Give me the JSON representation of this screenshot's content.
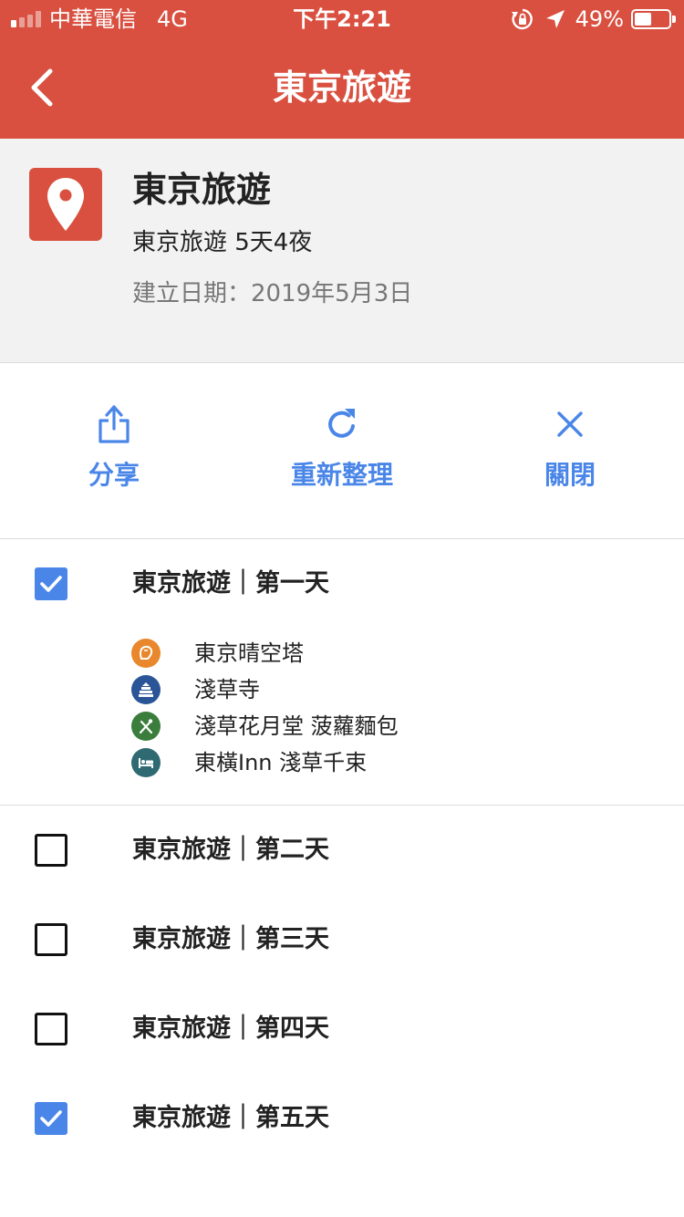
{
  "status_bar": {
    "carrier": "中華電信",
    "network": "4G",
    "time": "下午2:21",
    "battery_percent": "49%",
    "battery_level": 0.49,
    "signal_bars": 1,
    "icons": [
      "orientation-lock-icon",
      "location-arrow-icon",
      "battery-icon"
    ]
  },
  "header": {
    "title": "東京旅遊",
    "back_icon": "chevron-left-icon",
    "background_color": "#d95040"
  },
  "trip": {
    "icon": "map-pin-icon",
    "title": "東京旅遊",
    "subtitle": "東京旅遊 5天4夜",
    "created": "建立日期：2019年5月3日"
  },
  "actions": [
    {
      "label": "分享",
      "icon": "share-icon"
    },
    {
      "label": "重新整理",
      "icon": "refresh-icon"
    },
    {
      "label": "關閉",
      "icon": "close-icon"
    }
  ],
  "accent_color": "#4a86e8",
  "days": [
    {
      "label": "東京旅遊｜第一天",
      "checked": true,
      "places": [
        {
          "name": "東京晴空塔",
          "icon": "landmark-icon",
          "color": "#e8872b"
        },
        {
          "name": "淺草寺",
          "icon": "temple-icon",
          "color": "#2a5597"
        },
        {
          "name": "淺草花月堂 菠蘿麵包",
          "icon": "restaurant-icon",
          "color": "#3a7d3c"
        },
        {
          "name": "東橫Inn 淺草千束",
          "icon": "hotel-icon",
          "color": "#2f6a73"
        }
      ]
    },
    {
      "label": "東京旅遊｜第二天",
      "checked": false
    },
    {
      "label": "東京旅遊｜第三天",
      "checked": false
    },
    {
      "label": "東京旅遊｜第四天",
      "checked": false
    },
    {
      "label": "東京旅遊｜第五天",
      "checked": true
    }
  ]
}
